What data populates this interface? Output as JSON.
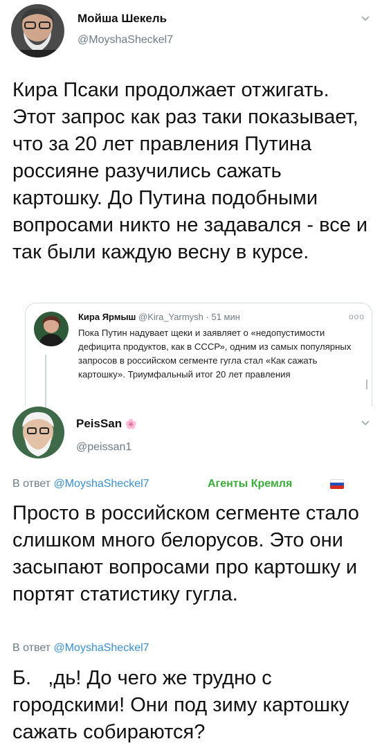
{
  "main_tweet": {
    "author_name": "Мойша Шекель",
    "author_handle": "@MoyshaSheckel7",
    "text": "Кира Псаки продолжает отжигать. Этот запрос как раз таки показывает, что за 20 лет правления Путина россияне разучились сажать картошку. До Путина подобными вопросами никто не задавался - все и так были каждую весну в курсе."
  },
  "quoted_tweet": {
    "author_name": "Кира Ярмыш",
    "author_handle": "@Kira_Yarmysh",
    "time": "51 мин",
    "more": "ooo",
    "text": "Пока Путин надувает щеки и заявляет о «недопустимости дефицита продуктов, как в СССР», одним из самых популярных запросов в российском сегменте гугла стал «Как сажать картошку». Триумфальный итог 20 лет правления"
  },
  "reply_tweet": {
    "author_name": "PeisSan",
    "author_emoji": "🌸",
    "author_handle": "@peissan1",
    "reply_prefix": "В ответ",
    "reply_to": "@MoyshaSheckel7",
    "group_label": "Агенты Кремля",
    "text": "Просто в российском сегменте стало слишком много белорусов. Это они засыпают вопросами про картошку и портят статистику гугла."
  },
  "second_reply": {
    "reply_prefix": "В ответ",
    "reply_to": "@MoyshaSheckel7",
    "text": "Б.   ,дь! До чего же трудно с городскими! Они под зиму картошку сажать собираются?"
  },
  "icons": [
    "avatar",
    "chevron-down-icon",
    "more-icon",
    "flag-icon"
  ],
  "colors": {
    "link": "#3a8fcf",
    "group": "#3bab3a",
    "muted": "#6e7b85"
  }
}
